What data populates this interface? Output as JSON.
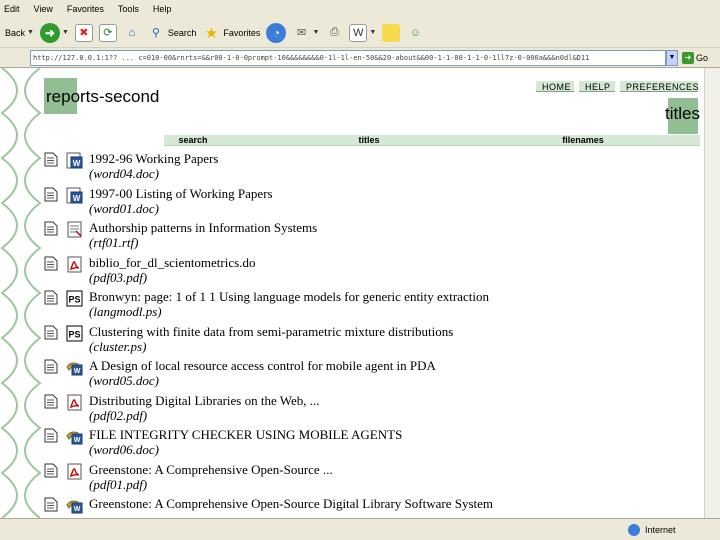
{
  "menu": [
    "Edit",
    "View",
    "Favorites",
    "Tools",
    "Help"
  ],
  "toolbar": {
    "back_label": "Back",
    "search_label": "Search",
    "favorites_label": "Favorites"
  },
  "address": {
    "url": "http://127.0.0.1:1?? ... c=010-00&rnrts=&&r00-1-0-0prompt-10&&&&&&&&0-1l-1l-en-50&&20-about&&00-1-1-00-1-1-0-1ll7z-0-000a&&&n0dl&D11"
  },
  "go_label": "Go",
  "page": {
    "title": "reports-second",
    "section_title": "titles",
    "nav": {
      "home": "HOME",
      "help": "HELP",
      "preferences": "PREFERENCES"
    },
    "tabs": {
      "search": "search",
      "titles": "titles",
      "filenames": "filenames"
    }
  },
  "results": [
    {
      "title": "1992-96 Working Papers",
      "file": "(word04.doc)",
      "type": "word"
    },
    {
      "title": "1997-00 Listing of Working Papers",
      "file": "(word01.doc)",
      "type": "word"
    },
    {
      "title": "Authorship patterns in Information Systems",
      "file": "(rtf01.rtf)",
      "type": "rtf"
    },
    {
      "title": "biblio_for_dl_scientometrics.do",
      "file": "(pdf03.pdf)",
      "type": "pdf"
    },
    {
      "title": "Bronwyn: page: 1 of 1 1 Using language models for generic entity extraction",
      "file": "(langmodl.ps)",
      "type": "ps"
    },
    {
      "title": "Clustering with finite data from semi-parametric mixture distributions",
      "file": "(cluster.ps)",
      "type": "ps"
    },
    {
      "title": "A Design of local resource access control for mobile agent in PDA",
      "file": "(word05.doc)",
      "type": "word-alt"
    },
    {
      "title": "Distributing Digital Libraries on the Web, ...",
      "file": "(pdf02.pdf)",
      "type": "pdf"
    },
    {
      "title": "FILE INTEGRITY CHECKER USING MOBILE AGENTS",
      "file": "(word06.doc)",
      "type": "word-alt"
    },
    {
      "title": "Greenstone: A Comprehensive Open-Source ...",
      "file": "(pdf01.pdf)",
      "type": "pdf"
    },
    {
      "title": "Greenstone:  A Comprehensive Open-Source Digital Library Software System",
      "file": "",
      "type": "word-alt"
    }
  ],
  "status": {
    "zone": "Internet"
  },
  "colors": {
    "accent_green": "#93bd93",
    "tab_green": "#d4e8d4",
    "chrome": "#ece9d8"
  }
}
